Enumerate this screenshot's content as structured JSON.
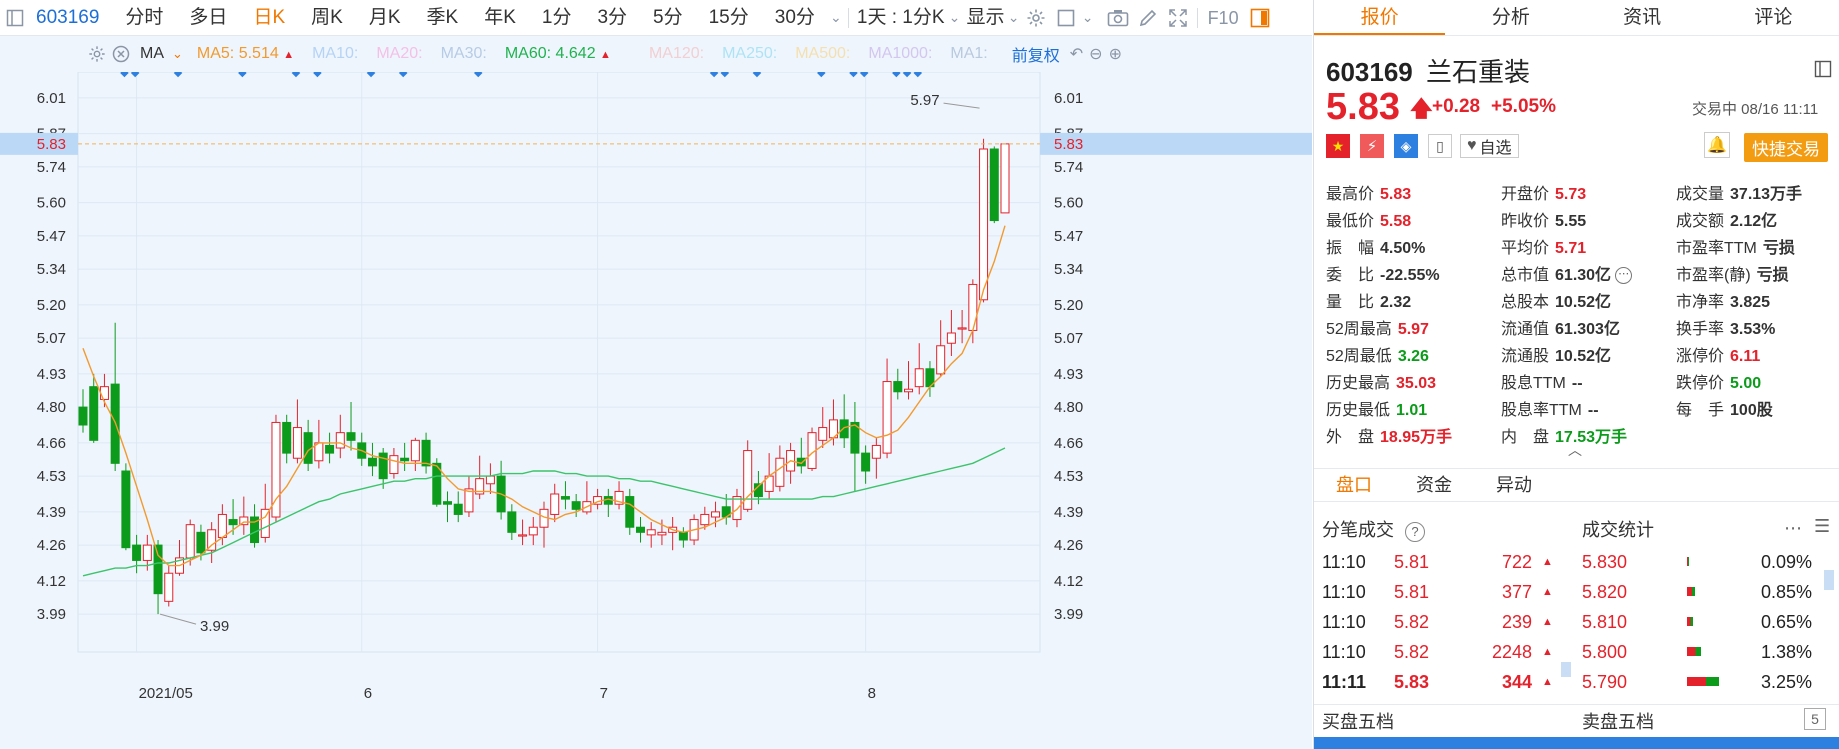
{
  "toolbar": {
    "code": "603169",
    "periods": [
      "分时",
      "多日",
      "日K",
      "周K",
      "月K",
      "季K",
      "年K",
      "1分",
      "3分",
      "5分",
      "15分",
      "30分"
    ],
    "active_period": "日K",
    "period_dropdown": "1天 : 1分K",
    "display_label": "显示",
    "f10_label": "F10"
  },
  "ma_bar": {
    "type_label": "MA",
    "ma5_label": "MA5:",
    "ma5_value": "5.514",
    "ma10_label": "MA10:",
    "ma20_label": "MA20:",
    "ma30_label": "MA30:",
    "ma60_label": "MA60:",
    "ma60_value": "4.642",
    "ma120_label": "MA120:",
    "ma250_label": "MA250:",
    "ma500_label": "MA500:",
    "ma1000_label": "MA1000:",
    "ma1_label": "MA1:",
    "adjust_label": "前复权"
  },
  "colors": {
    "up": "#e3222b",
    "down": "#0c9b1b",
    "ma5": "#f29a2e",
    "ma60": "#3cc46b",
    "accent": "#f07800",
    "link": "#1d6fd8",
    "chart_bg": "#eef5fd"
  },
  "chart": {
    "price_ticks": [
      "6.01",
      "5.87",
      "5.74",
      "5.60",
      "5.47",
      "5.34",
      "5.20",
      "5.07",
      "4.93",
      "4.80",
      "4.66",
      "4.53",
      "4.39",
      "4.26",
      "4.12",
      "3.99"
    ],
    "current_price_label": "5.83",
    "x_labels": [
      "2021/05",
      "6",
      "7",
      "8"
    ],
    "high_annotation": "5.97",
    "low_annotation": "3.99"
  },
  "chart_data": {
    "type": "candlestick",
    "ylim": [
      3.92,
      6.08
    ],
    "candles": [
      [
        4.8,
        4.73,
        4.87,
        4.7
      ],
      [
        4.88,
        4.67,
        4.93,
        4.66
      ],
      [
        4.83,
        4.88,
        4.93,
        4.8
      ],
      [
        4.89,
        4.58,
        5.13,
        4.55
      ],
      [
        4.55,
        4.25,
        4.58,
        4.24
      ],
      [
        4.26,
        4.2,
        4.3,
        4.15
      ],
      [
        4.2,
        4.26,
        4.3,
        4.16
      ],
      [
        4.26,
        4.07,
        4.28,
        3.99
      ],
      [
        4.04,
        4.15,
        4.18,
        4.02
      ],
      [
        4.15,
        4.21,
        4.28,
        4.14
      ],
      [
        4.21,
        4.34,
        4.36,
        4.18
      ],
      [
        4.31,
        4.23,
        4.34,
        4.2
      ],
      [
        4.24,
        4.32,
        4.35,
        4.19
      ],
      [
        4.29,
        4.38,
        4.42,
        4.26
      ],
      [
        4.36,
        4.34,
        4.44,
        4.3
      ],
      [
        4.34,
        4.37,
        4.45,
        4.3
      ],
      [
        4.37,
        4.27,
        4.42,
        4.25
      ],
      [
        4.29,
        4.4,
        4.5,
        4.27
      ],
      [
        4.37,
        4.74,
        4.77,
        4.35
      ],
      [
        4.74,
        4.62,
        4.77,
        4.58
      ],
      [
        4.6,
        4.72,
        4.83,
        4.58
      ],
      [
        4.7,
        4.58,
        4.75,
        4.55
      ],
      [
        4.59,
        4.66,
        4.75,
        4.56
      ],
      [
        4.65,
        4.62,
        4.7,
        4.58
      ],
      [
        4.64,
        4.7,
        4.77,
        4.6
      ],
      [
        4.7,
        4.67,
        4.82,
        4.63
      ],
      [
        4.66,
        4.6,
        4.7,
        4.57
      ],
      [
        4.6,
        4.57,
        4.66,
        4.53
      ],
      [
        4.62,
        4.52,
        4.64,
        4.48
      ],
      [
        4.54,
        4.61,
        4.64,
        4.52
      ],
      [
        4.6,
        4.59,
        4.66,
        4.55
      ],
      [
        4.59,
        4.67,
        4.68,
        4.55
      ],
      [
        4.67,
        4.57,
        4.7,
        4.54
      ],
      [
        4.58,
        4.42,
        4.6,
        4.41
      ],
      [
        4.43,
        4.42,
        4.47,
        4.35
      ],
      [
        4.42,
        4.38,
        4.47,
        4.35
      ],
      [
        4.39,
        4.48,
        4.53,
        4.37
      ],
      [
        4.46,
        4.52,
        4.61,
        4.44
      ],
      [
        4.5,
        4.53,
        4.58,
        4.46
      ],
      [
        4.53,
        4.39,
        4.59,
        4.36
      ],
      [
        4.39,
        4.31,
        4.42,
        4.28
      ],
      [
        4.3,
        4.3,
        4.36,
        4.26
      ],
      [
        4.3,
        4.33,
        4.37,
        4.26
      ],
      [
        4.33,
        4.4,
        4.43,
        4.25
      ],
      [
        4.38,
        4.46,
        4.5,
        4.35
      ],
      [
        4.45,
        4.44,
        4.51,
        4.4
      ],
      [
        4.43,
        4.4,
        4.46,
        4.37
      ],
      [
        4.39,
        4.43,
        4.51,
        4.38
      ],
      [
        4.42,
        4.45,
        4.48,
        4.4
      ],
      [
        4.45,
        4.42,
        4.48,
        4.37
      ],
      [
        4.42,
        4.47,
        4.51,
        4.4
      ],
      [
        4.45,
        4.33,
        4.48,
        4.3
      ],
      [
        4.33,
        4.31,
        4.37,
        4.27
      ],
      [
        4.3,
        4.32,
        4.35,
        4.25
      ],
      [
        4.3,
        4.31,
        4.36,
        4.26
      ],
      [
        4.31,
        4.33,
        4.37,
        4.24
      ],
      [
        4.31,
        4.28,
        4.33,
        4.25
      ],
      [
        4.28,
        4.36,
        4.38,
        4.26
      ],
      [
        4.34,
        4.38,
        4.41,
        4.32
      ],
      [
        4.37,
        4.39,
        4.43,
        4.33
      ],
      [
        4.41,
        4.37,
        4.46,
        4.34
      ],
      [
        4.36,
        4.45,
        4.48,
        4.33
      ],
      [
        4.4,
        4.63,
        4.67,
        4.39
      ],
      [
        4.5,
        4.45,
        4.55,
        4.42
      ],
      [
        4.47,
        4.53,
        4.62,
        4.44
      ],
      [
        4.49,
        4.6,
        4.65,
        4.47
      ],
      [
        4.55,
        4.63,
        4.66,
        4.5
      ],
      [
        4.6,
        4.57,
        4.68,
        4.54
      ],
      [
        4.56,
        4.7,
        4.72,
        4.55
      ],
      [
        4.67,
        4.72,
        4.8,
        4.64
      ],
      [
        4.68,
        4.75,
        4.83,
        4.65
      ],
      [
        4.75,
        4.68,
        4.85,
        4.64
      ],
      [
        4.74,
        4.62,
        4.82,
        4.47
      ],
      [
        4.62,
        4.55,
        4.65,
        4.5
      ],
      [
        4.6,
        4.65,
        4.68,
        4.52
      ],
      [
        4.62,
        4.9,
        4.99,
        4.6
      ],
      [
        4.9,
        4.86,
        4.95,
        4.83
      ],
      [
        4.86,
        4.87,
        4.98,
        4.83
      ],
      [
        4.88,
        4.95,
        5.05,
        4.85
      ],
      [
        4.95,
        4.88,
        4.98,
        4.84
      ],
      [
        4.93,
        5.04,
        5.14,
        4.92
      ],
      [
        5.05,
        5.09,
        5.18,
        5.0
      ],
      [
        5.11,
        5.11,
        5.18,
        5.05
      ],
      [
        5.1,
        5.28,
        5.3,
        5.05
      ],
      [
        5.22,
        5.81,
        5.85,
        5.21
      ],
      [
        5.81,
        5.53,
        5.82,
        5.52
      ],
      [
        5.56,
        5.83,
        5.83,
        5.58
      ]
    ],
    "ma5": [
      5.03,
      4.92,
      4.82,
      4.74,
      4.62,
      4.49,
      4.36,
      4.22,
      4.18,
      4.18,
      4.2,
      4.22,
      4.26,
      4.29,
      4.32,
      4.35,
      4.35,
      4.37,
      4.44,
      4.49,
      4.56,
      4.63,
      4.66,
      4.66,
      4.66,
      4.64,
      4.63,
      4.61,
      4.6,
      4.59,
      4.58,
      4.58,
      4.58,
      4.57,
      4.52,
      4.48,
      4.47,
      4.47,
      4.47,
      4.46,
      4.44,
      4.41,
      4.39,
      4.37,
      4.36,
      4.38,
      4.39,
      4.41,
      4.43,
      4.44,
      4.43,
      4.42,
      4.39,
      4.36,
      4.34,
      4.32,
      4.31,
      4.32,
      4.33,
      4.35,
      4.37,
      4.4,
      4.45,
      4.49,
      4.53,
      4.56,
      4.59,
      4.58,
      4.62,
      4.65,
      4.68,
      4.72,
      4.73,
      4.7,
      4.68,
      4.69,
      4.71,
      4.76,
      4.82,
      4.88,
      4.92,
      4.97,
      5.01,
      5.1,
      5.26,
      5.37,
      5.51
    ],
    "ma60": [
      4.14,
      4.15,
      4.16,
      4.17,
      4.17,
      4.18,
      4.18,
      4.19,
      4.19,
      4.2,
      4.21,
      4.22,
      4.23,
      4.25,
      4.27,
      4.29,
      4.31,
      4.33,
      4.35,
      4.37,
      4.39,
      4.41,
      4.43,
      4.44,
      4.46,
      4.47,
      4.48,
      4.49,
      4.5,
      4.51,
      4.51,
      4.52,
      4.52,
      4.53,
      4.53,
      4.53,
      4.53,
      4.53,
      4.53,
      4.54,
      4.54,
      4.54,
      4.55,
      4.55,
      4.55,
      4.54,
      4.54,
      4.53,
      4.53,
      4.53,
      4.52,
      4.52,
      4.51,
      4.51,
      4.5,
      4.49,
      4.48,
      4.47,
      4.46,
      4.45,
      4.44,
      4.44,
      4.44,
      4.44,
      4.44,
      4.44,
      4.44,
      4.44,
      4.44,
      4.45,
      4.45,
      4.46,
      4.47,
      4.48,
      4.49,
      4.5,
      4.51,
      4.52,
      4.53,
      4.54,
      4.55,
      4.56,
      4.57,
      4.58,
      4.6,
      4.62,
      4.64
    ]
  },
  "quote": {
    "code": "603169",
    "name": "兰石重装",
    "price": "5.83",
    "change": "+0.28",
    "change_pct": "+5.05%",
    "status": "交易中 08/16 11:11",
    "watch_label": "自选",
    "trade_button": "快捷交易",
    "fields": [
      [
        [
          "最高价",
          "5.83",
          "red"
        ],
        [
          "开盘价",
          "5.73",
          "red"
        ],
        [
          "成交量",
          "37.13万手",
          "gray"
        ]
      ],
      [
        [
          "最低价",
          "5.58",
          "red"
        ],
        [
          "昨收价",
          "5.55",
          "gray"
        ],
        [
          "成交额",
          "2.12亿",
          "gray"
        ]
      ],
      [
        [
          "振　幅",
          "4.50%",
          "gray"
        ],
        [
          "平均价",
          "5.71",
          "red"
        ],
        [
          "市盈率TTM",
          "亏损",
          "gray"
        ]
      ],
      [
        [
          "委　比",
          "-22.55%",
          "gray"
        ],
        [
          "总市值",
          "61.30亿",
          "gray"
        ],
        [
          "市盈率(静)",
          "亏损",
          "gray"
        ]
      ],
      [
        [
          "量　比",
          "2.32",
          "gray"
        ],
        [
          "总股本",
          "10.52亿",
          "gray"
        ],
        [
          "市净率",
          "3.825",
          "gray"
        ]
      ],
      [
        [
          "52周最高",
          "5.97",
          "red"
        ],
        [
          "流通值",
          "61.303亿",
          "gray"
        ],
        [
          "换手率",
          "3.53%",
          "gray"
        ]
      ],
      [
        [
          "52周最低",
          "3.26",
          "green"
        ],
        [
          "流通股",
          "10.52亿",
          "gray"
        ],
        [
          "涨停价",
          "6.11",
          "red"
        ]
      ],
      [
        [
          "历史最高",
          "35.03",
          "red"
        ],
        [
          "股息TTM",
          "--",
          "gray"
        ],
        [
          "跌停价",
          "5.00",
          "green"
        ]
      ],
      [
        [
          "历史最低",
          "1.01",
          "green"
        ],
        [
          "股息率TTM",
          "--",
          "gray"
        ],
        [
          "每　手",
          "100股",
          "gray"
        ]
      ],
      [
        [
          "外　盘",
          "18.95万手",
          "red"
        ],
        [
          "内　盘",
          "17.53万手",
          "green"
        ],
        [
          "",
          "",
          " gray"
        ]
      ]
    ]
  },
  "panel_tabs": [
    "报价",
    "分析",
    "资讯",
    "评论"
  ],
  "sub_tabs": [
    "盘口",
    "资金",
    "异动"
  ],
  "ticks": {
    "title": "分笔成交",
    "rows": [
      [
        "11:10",
        "5.81",
        "722"
      ],
      [
        "11:10",
        "5.81",
        "377"
      ],
      [
        "11:10",
        "5.82",
        "239"
      ],
      [
        "11:10",
        "5.82",
        "2248"
      ],
      [
        "11:11",
        "5.83",
        "344"
      ]
    ]
  },
  "stats": {
    "title": "成交统计",
    "rows": [
      [
        "5.830",
        "0.09%"
      ],
      [
        "5.820",
        "0.85%"
      ],
      [
        "5.810",
        "0.65%"
      ],
      [
        "5.800",
        "1.38%"
      ],
      [
        "5.790",
        "3.25%"
      ]
    ]
  },
  "order_book": {
    "buy_label": "买盘五档",
    "sell_label": "卖盘五档"
  }
}
